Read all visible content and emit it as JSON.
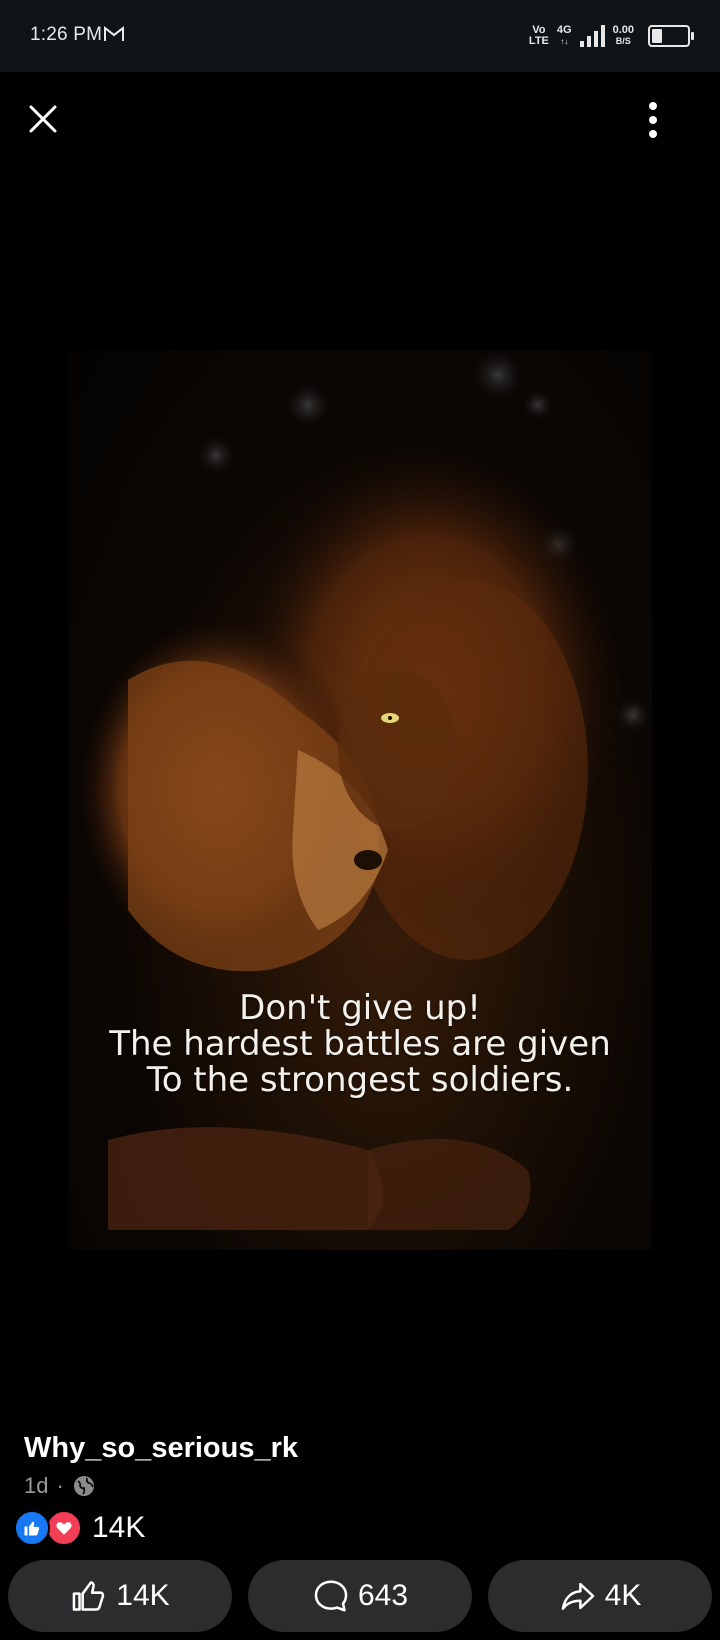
{
  "status_bar": {
    "time": "1:26 PM",
    "volte_top": "Vo",
    "volte_bottom": "LTE",
    "network": "4G",
    "speed_top": "0.00",
    "speed_bottom": "B/S",
    "battery_level": "1"
  },
  "post": {
    "caption_lines": [
      "Don't give up!",
      "The hardest battles are given",
      "To the strongest soldiers."
    ],
    "author": "Why_so_serious_rk",
    "time_ago": "1d",
    "separator": "·",
    "reaction_count": "14K"
  },
  "actions": {
    "like_label": "14K",
    "comment_label": "643",
    "share_label": "4K"
  },
  "colors": {
    "like_blue": "#1877f2",
    "love_red": "#f33e58",
    "button_bg": "#2a2c2e"
  }
}
